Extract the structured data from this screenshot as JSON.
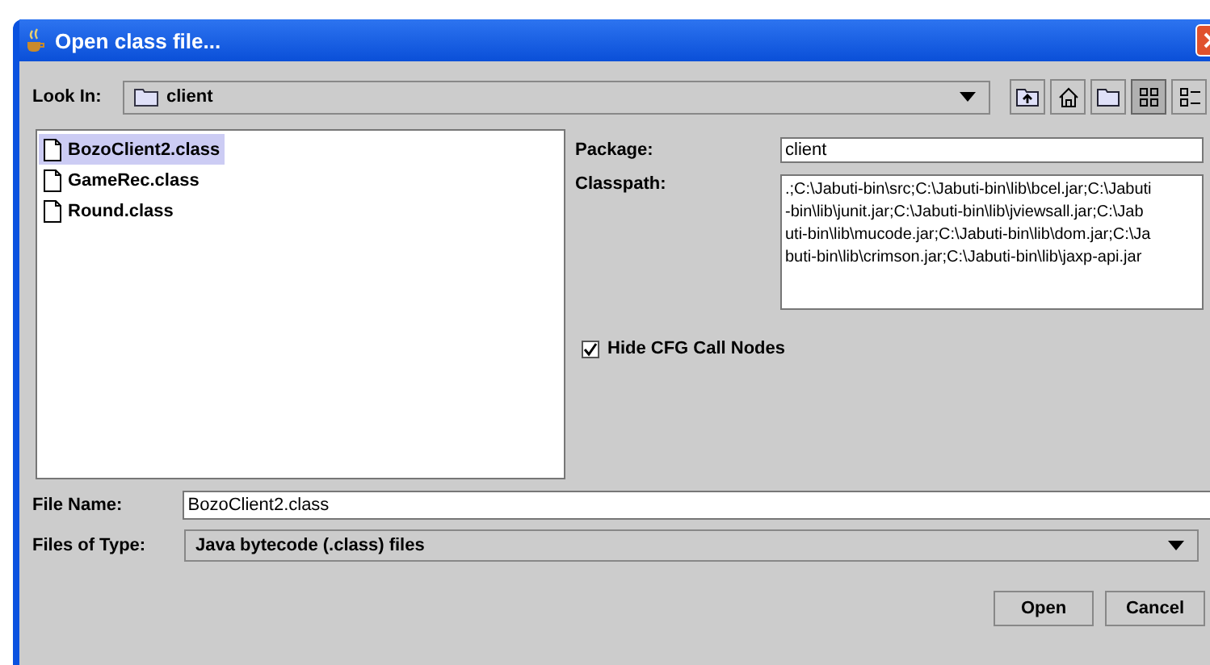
{
  "window": {
    "title": "Open class file..."
  },
  "look_in": {
    "label": "Look In:",
    "value": "client"
  },
  "toolbar": [
    {
      "kind": "up",
      "selected": false
    },
    {
      "kind": "home",
      "selected": false
    },
    {
      "kind": "new-folder",
      "selected": false
    },
    {
      "kind": "list",
      "selected": true
    },
    {
      "kind": "details",
      "selected": false
    }
  ],
  "files": [
    {
      "name": "BozoClient2.class",
      "selected": true
    },
    {
      "name": "GameRec.class",
      "selected": false
    },
    {
      "name": "Round.class",
      "selected": false
    }
  ],
  "package": {
    "label": "Package:",
    "value": "client"
  },
  "classpath": {
    "label": "Classpath:",
    "lines": [
      ".;C:\\Jabuti-bin\\src;C:\\Jabuti-bin\\lib\\bcel.jar;C:\\Jabuti",
      "-bin\\lib\\junit.jar;C:\\Jabuti-bin\\lib\\jviewsall.jar;C:\\Jab",
      "uti-bin\\lib\\mucode.jar;C:\\Jabuti-bin\\lib\\dom.jar;C:\\Ja",
      "buti-bin\\lib\\crimson.jar;C:\\Jabuti-bin\\lib\\jaxp-api.jar"
    ]
  },
  "hide_cfg": {
    "label": "Hide CFG Call Nodes",
    "checked": true
  },
  "file_name": {
    "label": "File Name:",
    "value": "BozoClient2.class"
  },
  "file_type": {
    "label": "Files of Type:",
    "value": "Java bytecode (.class) files"
  },
  "buttons": [
    "Open",
    "Cancel"
  ]
}
